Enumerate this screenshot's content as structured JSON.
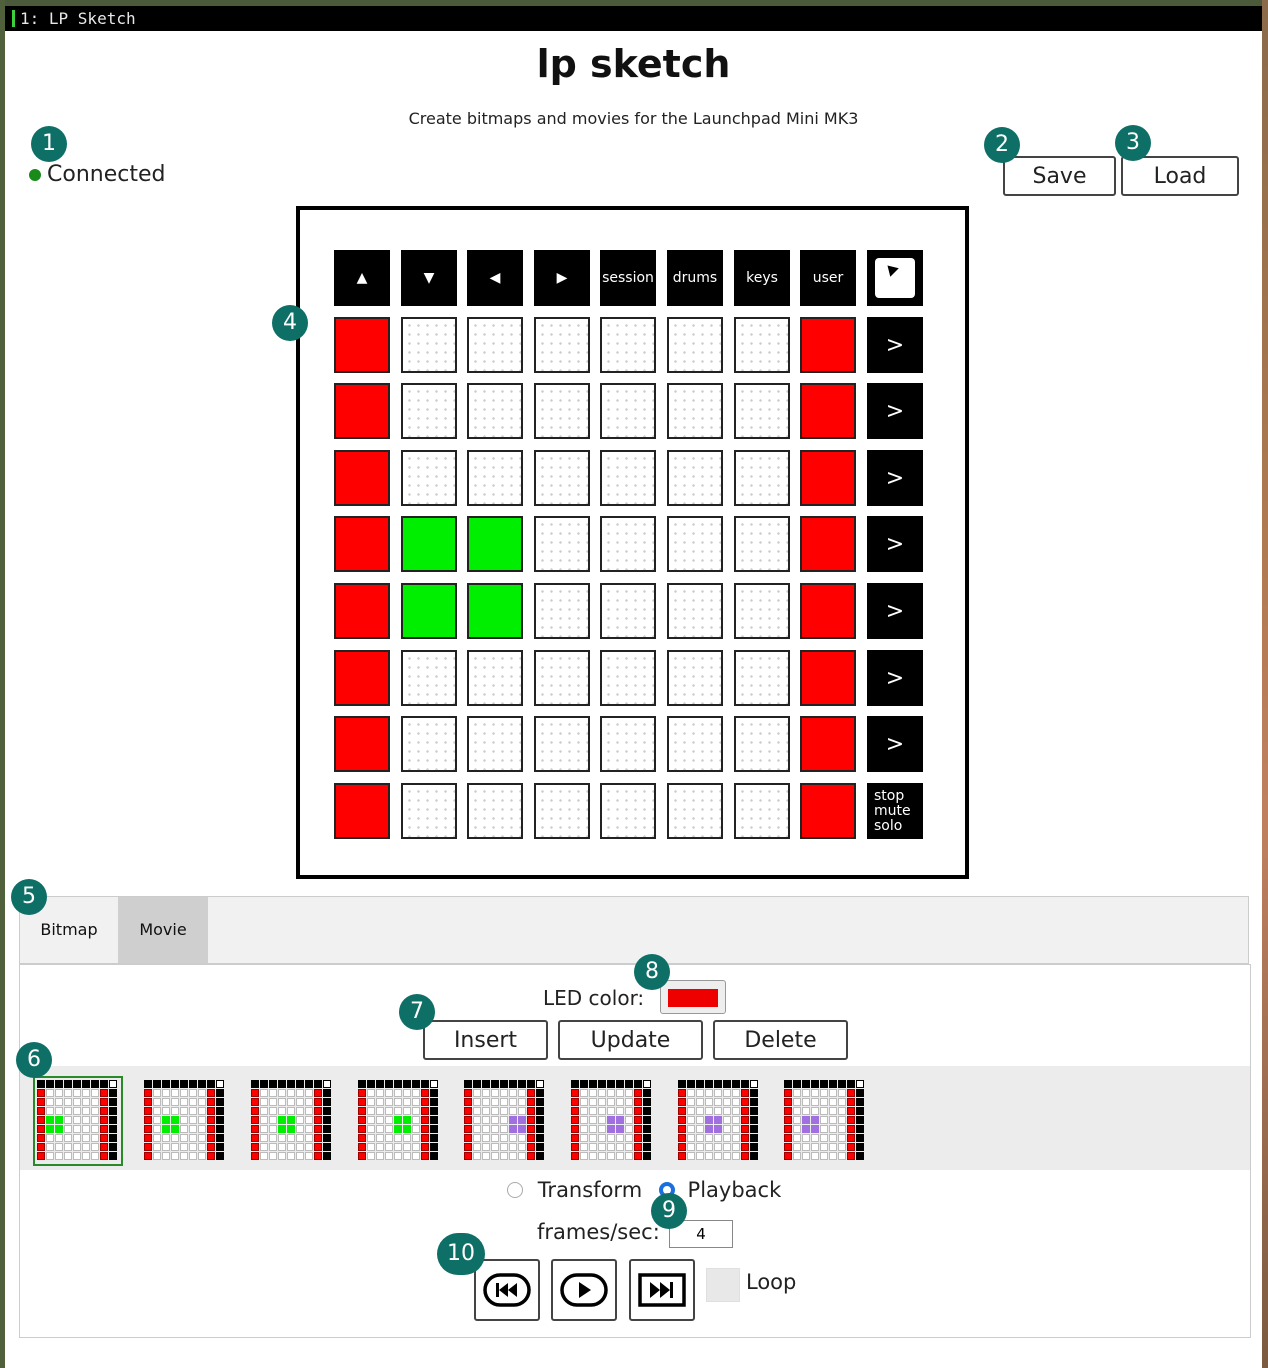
{
  "window": {
    "title": "1: LP Sketch"
  },
  "header": {
    "title": "lp sketch",
    "subtitle": "Create bitmaps and movies for the Launchpad Mini MK3"
  },
  "status": {
    "label": "Connected",
    "color": "#1a8a1a"
  },
  "toolbar": {
    "save_label": "Save",
    "load_label": "Load"
  },
  "launchpad": {
    "top_buttons": [
      "▲",
      "▼",
      "◀",
      "▶",
      "session",
      "drums",
      "keys",
      "user"
    ],
    "logo_icon": "launchpad-logo-icon",
    "side_buttons": [
      ">",
      ">",
      ">",
      ">",
      ">",
      ">",
      ">"
    ],
    "side_last": [
      "stop",
      "mute",
      "solo"
    ],
    "grid": [
      "R......R",
      "R......R",
      "R......R",
      "RGG....R",
      "RGG....R",
      "R......R",
      "R......R",
      "R......R"
    ],
    "colors": {
      "R": "#ff0000",
      "G": "#00ee00",
      "P": "#a070e0"
    }
  },
  "tabs": [
    {
      "label": "Bitmap"
    },
    {
      "label": "Movie"
    }
  ],
  "active_tab": "Movie",
  "movie": {
    "led_color_label": "LED color:",
    "led_color": "#ee0000",
    "insert_label": "Insert",
    "update_label": "Update",
    "delete_label": "Delete",
    "selected_frame": 0,
    "frames": [
      {
        "blob": "G",
        "blob_col": 1,
        "blob_row": 4
      },
      {
        "blob": "G",
        "blob_col": 2,
        "blob_row": 4
      },
      {
        "blob": "G",
        "blob_col": 3,
        "blob_row": 4
      },
      {
        "blob": "G",
        "blob_col": 4,
        "blob_row": 4
      },
      {
        "blob": "P",
        "blob_col": 5,
        "blob_row": 4
      },
      {
        "blob": "P",
        "blob_col": 4,
        "blob_row": 4
      },
      {
        "blob": "P",
        "blob_col": 3,
        "blob_row": 4
      },
      {
        "blob": "P",
        "blob_col": 2,
        "blob_row": 4
      }
    ],
    "transform_label": "Transform",
    "playback_label": "Playback",
    "mode": "Playback",
    "fps_label": "frames/sec:",
    "fps_value": "4",
    "loop_label": "Loop",
    "loop_checked": false,
    "icons": [
      "rewind-icon",
      "play-icon",
      "fast-forward-icon"
    ]
  },
  "callouts": [
    "1",
    "2",
    "3",
    "4",
    "5",
    "6",
    "7",
    "8",
    "9",
    "10"
  ]
}
